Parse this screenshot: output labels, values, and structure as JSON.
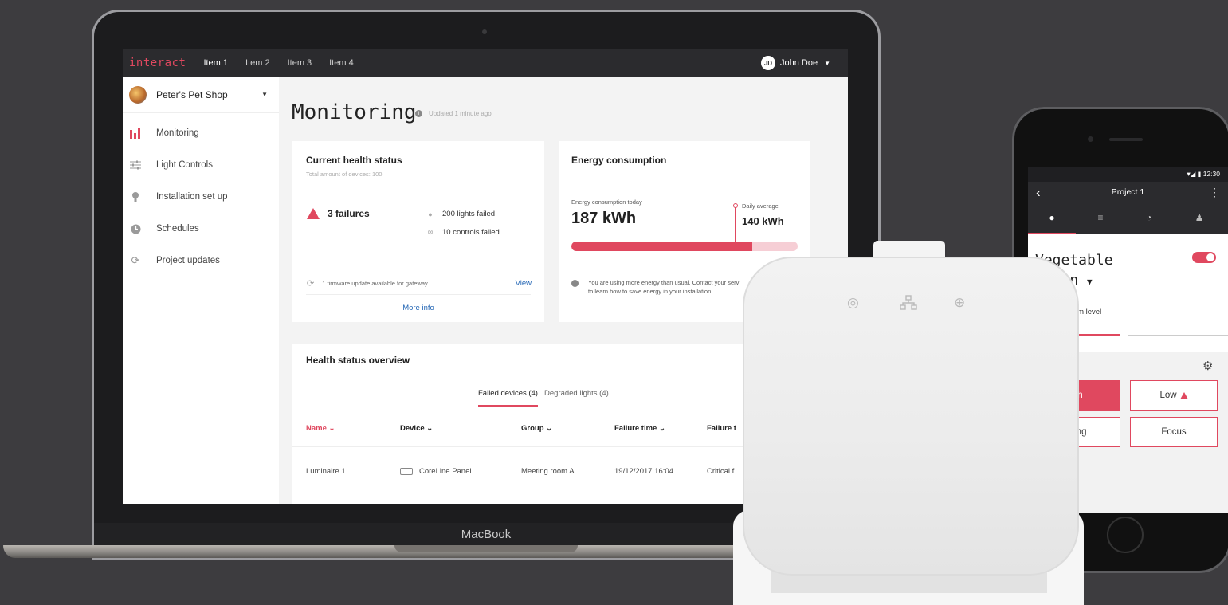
{
  "app": {
    "brand": "interact",
    "nav": [
      "Item 1",
      "Item 2",
      "Item 3",
      "Item 4"
    ],
    "user": {
      "initials": "JD",
      "name": "John Doe"
    }
  },
  "sidebar": {
    "shop": "Peter's Pet Shop",
    "items": [
      {
        "label": "Monitoring",
        "icon": "bar-chart-icon",
        "active": true
      },
      {
        "label": "Light Controls",
        "icon": "sliders-icon"
      },
      {
        "label": "Installation set up",
        "icon": "bulb-icon"
      },
      {
        "label": "Schedules",
        "icon": "clock-icon"
      },
      {
        "label": "Project updates",
        "icon": "refresh-icon"
      }
    ]
  },
  "page": {
    "title": "Monitoring",
    "updated": "Updated 1 minute ago"
  },
  "health": {
    "title": "Current health status",
    "subtitle": "Total amount of devices: 100",
    "failures": "3 failures",
    "lights_failed": "200 lights failed",
    "controls_failed": "10 controls failed",
    "firmware": "1 firmware update available for gateway",
    "view": "View",
    "more_info": "More info"
  },
  "energy": {
    "title": "Energy consumption",
    "today_label": "Energy consumption today",
    "today_value": "187 kWh",
    "avg_label": "Daily average",
    "avg_value": "140 kWh",
    "today_fraction": 0.8,
    "message_line1": "You are using more energy than usual. Contact your serv",
    "message_line2": "to learn how to save energy in your installation."
  },
  "overview": {
    "title": "Health status overview",
    "tabs": [
      "Failed devices (4)",
      "Degraded lights (4)"
    ],
    "columns": [
      "Name",
      "Device",
      "Group",
      "Failure time",
      "Failure t"
    ],
    "rows": [
      {
        "name": "Luminaire 1",
        "device": "CoreLine Panel",
        "group": "Meeting room A",
        "time": "19/12/2017 16:04",
        "type": "Critical f"
      }
    ]
  },
  "laptop_brand": "MacBook",
  "phone": {
    "time": "12:30",
    "title": "Project 1",
    "zone_line1": "Vegetable",
    "zone_line2": "ction",
    "dim_label": "im level",
    "buttons": [
      "igh",
      "Low",
      "eting",
      "Focus"
    ]
  }
}
